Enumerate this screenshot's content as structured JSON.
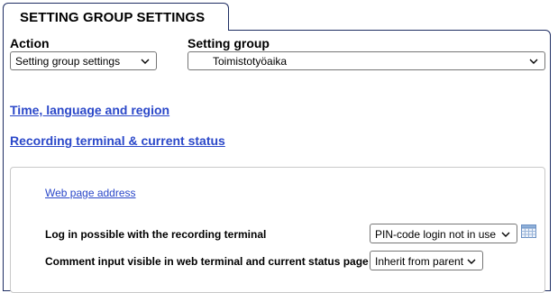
{
  "tab": {
    "title": "SETTING GROUP SETTINGS"
  },
  "action": {
    "label": "Action",
    "selected": "Setting group settings"
  },
  "setting_group": {
    "label": "Setting group",
    "selected": "Toimistotyöaika"
  },
  "links": {
    "time_language_region": "Time, language and region",
    "recording_terminal": "Recording terminal & current status"
  },
  "recording_section": {
    "web_page_address": "Web page address",
    "fields": [
      {
        "label": "Log in possible with the recording terminal",
        "value": "PIN-code login not in use"
      },
      {
        "label": "Comment input visible in web terminal and current status page",
        "value": "Inherit from parent"
      }
    ]
  },
  "icons": {
    "chevron": "chevron-down-icon",
    "calendar": "calendar-icon"
  }
}
